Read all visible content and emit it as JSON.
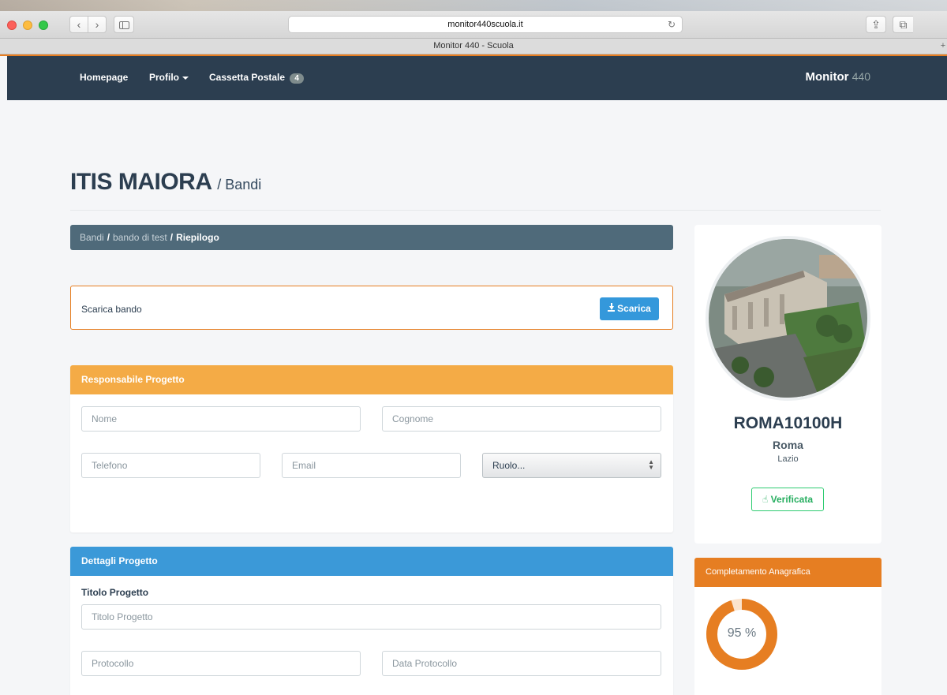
{
  "browser": {
    "url": "monitor440scuola.it",
    "tab_title": "Monitor 440 - Scuola"
  },
  "navbar": {
    "home_label": "Homepage",
    "profile_label": "Profilo",
    "mailbox_label": "Cassetta Postale",
    "mailbox_count": "4",
    "brand_name": "Monitor",
    "brand_number": "440"
  },
  "page": {
    "title": "ITIS MAIORA",
    "subtitle": "/ Bandi"
  },
  "breadcrumb": {
    "items": [
      "Bandi",
      "bando di test",
      "Riepilogo"
    ],
    "separator": "/"
  },
  "download": {
    "label": "Scarica bando",
    "button_label": "Scarica"
  },
  "responsabile": {
    "heading": "Responsabile Progetto",
    "nome_placeholder": "Nome",
    "cognome_placeholder": "Cognome",
    "telefono_placeholder": "Telefono",
    "email_placeholder": "Email",
    "ruolo_selected": "Ruolo..."
  },
  "dettagli": {
    "heading": "Dettagli Progetto",
    "titolo_label": "Titolo Progetto",
    "titolo_placeholder": "Titolo Progetto",
    "protocollo_placeholder": "Protocollo",
    "data_protocollo_placeholder": "Data Protocollo"
  },
  "school": {
    "code": "ROMA10100H",
    "city": "Roma",
    "region": "Lazio",
    "status_label": "Verificata"
  },
  "completion": {
    "heading": "Completamento Anagrafica",
    "percent_label": "95 %",
    "percent_value": 95
  },
  "colors": {
    "navbar": "#2c3e50",
    "accent_orange": "#e67e22",
    "panel_orange": "#f4ab46",
    "panel_blue": "#3b99d8",
    "button_blue": "#3498db",
    "verified_green": "#27ae60"
  }
}
